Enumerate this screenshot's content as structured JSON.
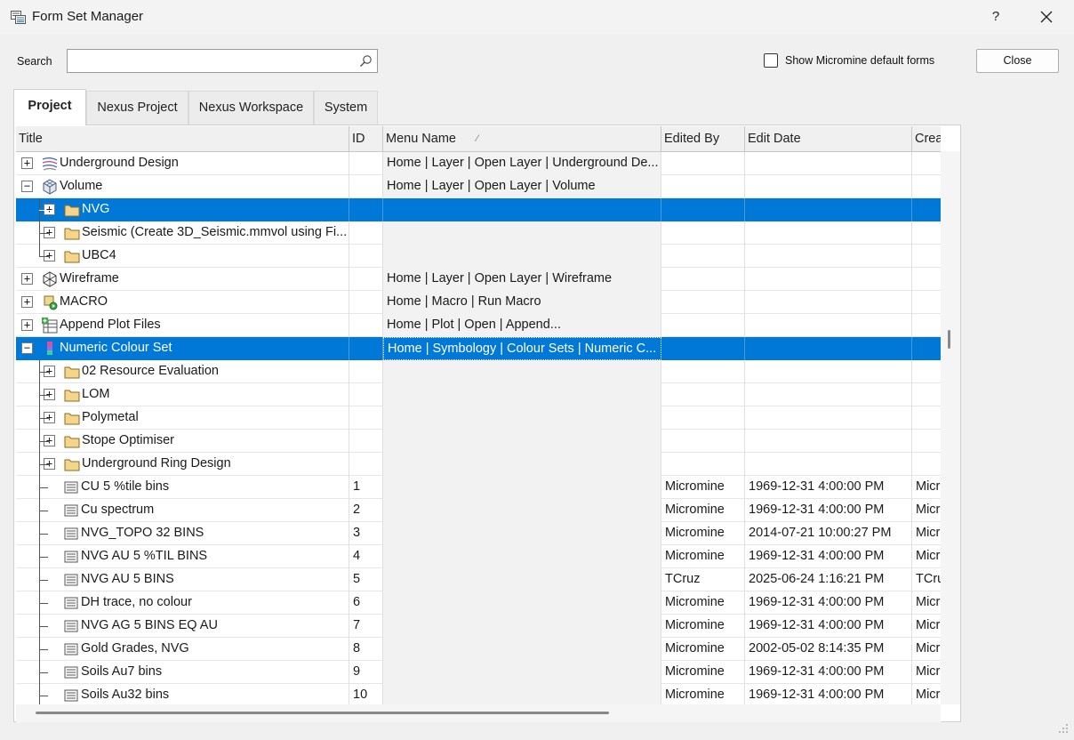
{
  "window": {
    "title": "Form Set Manager",
    "help": "?"
  },
  "search": {
    "label": "Search",
    "value": "",
    "placeholder": ""
  },
  "options": {
    "show_default_label": "Show Micromine default forms",
    "show_default_checked": false,
    "close_label": "Close"
  },
  "tabs": [
    {
      "label": "Project",
      "active": true
    },
    {
      "label": "Nexus Project",
      "active": false
    },
    {
      "label": "Nexus Workspace",
      "active": false
    },
    {
      "label": "System",
      "active": false
    }
  ],
  "columns": {
    "title": "Title",
    "id": "ID",
    "menu_name": "Menu Name",
    "sort_glyph": "⁄",
    "edited_by": "Edited By",
    "edit_date": "Edit Date",
    "created": "Crea"
  },
  "rows": [
    {
      "title": "Underground Design",
      "id": "",
      "menu": "Home | Layer | Open Layer | Underground De...",
      "edited_by": "",
      "edit_date": "",
      "created": ""
    },
    {
      "title": "Volume",
      "id": "",
      "menu": "Home | Layer | Open Layer | Volume",
      "edited_by": "",
      "edit_date": "",
      "created": ""
    },
    {
      "title": "NVG",
      "id": "",
      "menu": "",
      "edited_by": "",
      "edit_date": "",
      "created": ""
    },
    {
      "title": "Seismic (Create 3D_Seismic.mmvol using Fi...",
      "id": "",
      "menu": "",
      "edited_by": "",
      "edit_date": "",
      "created": ""
    },
    {
      "title": "UBC4",
      "id": "",
      "menu": "",
      "edited_by": "",
      "edit_date": "",
      "created": ""
    },
    {
      "title": "Wireframe",
      "id": "",
      "menu": "Home | Layer | Open Layer | Wireframe",
      "edited_by": "",
      "edit_date": "",
      "created": ""
    },
    {
      "title": "MACRO",
      "id": "",
      "menu": "Home | Macro | Run Macro",
      "edited_by": "",
      "edit_date": "",
      "created": ""
    },
    {
      "title": "Append Plot Files",
      "id": "",
      "menu": "Home | Plot | Open | Append...",
      "edited_by": "",
      "edit_date": "",
      "created": ""
    },
    {
      "title": "Numeric Colour Set",
      "id": "",
      "menu": "Home | Symbology | Colour Sets | Numeric C...",
      "edited_by": "",
      "edit_date": "",
      "created": ""
    },
    {
      "title": "02 Resource Evaluation",
      "id": "",
      "menu": "",
      "edited_by": "",
      "edit_date": "",
      "created": ""
    },
    {
      "title": "LOM",
      "id": "",
      "menu": "",
      "edited_by": "",
      "edit_date": "",
      "created": ""
    },
    {
      "title": "Polymetal",
      "id": "",
      "menu": "",
      "edited_by": "",
      "edit_date": "",
      "created": ""
    },
    {
      "title": "Stope Optimiser",
      "id": "",
      "menu": "",
      "edited_by": "",
      "edit_date": "",
      "created": ""
    },
    {
      "title": "Underground Ring Design",
      "id": "",
      "menu": "",
      "edited_by": "",
      "edit_date": "",
      "created": ""
    },
    {
      "title": "CU 5 %tile bins",
      "id": "1",
      "menu": "",
      "edited_by": "Micromine",
      "edit_date": "1969-12-31 4:00:00 PM",
      "created": "Micr"
    },
    {
      "title": "Cu spectrum",
      "id": "2",
      "menu": "",
      "edited_by": "Micromine",
      "edit_date": "1969-12-31 4:00:00 PM",
      "created": "Micr"
    },
    {
      "title": "NVG_TOPO 32 BINS",
      "id": "3",
      "menu": "",
      "edited_by": "Micromine",
      "edit_date": "2014-07-21 10:00:27 PM",
      "created": "Micr"
    },
    {
      "title": "NVG AU 5 %TIL  BINS",
      "id": "4",
      "menu": "",
      "edited_by": "Micromine",
      "edit_date": "1969-12-31 4:00:00 PM",
      "created": "Micr"
    },
    {
      "title": "NVG AU 5 BINS",
      "id": "5",
      "menu": "",
      "edited_by": "TCruz",
      "edit_date": "2025-06-24 1:16:21 PM",
      "created": "TCru"
    },
    {
      "title": "DH trace, no colour",
      "id": "6",
      "menu": "",
      "edited_by": "Micromine",
      "edit_date": "1969-12-31 4:00:00 PM",
      "created": "Micr"
    },
    {
      "title": "NVG AG 5 BINS EQ AU",
      "id": "7",
      "menu": "",
      "edited_by": "Micromine",
      "edit_date": "1969-12-31 4:00:00 PM",
      "created": "Micr"
    },
    {
      "title": "Gold Grades, NVG",
      "id": "8",
      "menu": "",
      "edited_by": "Micromine",
      "edit_date": "2002-05-02 8:14:35 PM",
      "created": "Micr"
    },
    {
      "title": "Soils Au7 bins",
      "id": "9",
      "menu": "",
      "edited_by": "Micromine",
      "edit_date": "1969-12-31 4:00:00 PM",
      "created": "Micr"
    },
    {
      "title": "Soils Au32 bins",
      "id": "10",
      "menu": "",
      "edited_by": "Micromine",
      "edit_date": "1969-12-31 4:00:00 PM",
      "created": "Micr"
    }
  ],
  "tree_icons": [
    "underground-design-icon",
    "volume-icon",
    "folder-icon",
    "folder-icon",
    "folder-icon",
    "wireframe-icon",
    "macro-icon",
    "append-plot-icon",
    "numeric-colour-set-icon",
    "folder-icon",
    "folder-icon",
    "folder-icon",
    "folder-icon",
    "folder-icon",
    "form-icon"
  ],
  "colors": {
    "selection": "#0078d7",
    "folder": "#f5d58a",
    "menu_column_bg": "#f2f2f2"
  }
}
